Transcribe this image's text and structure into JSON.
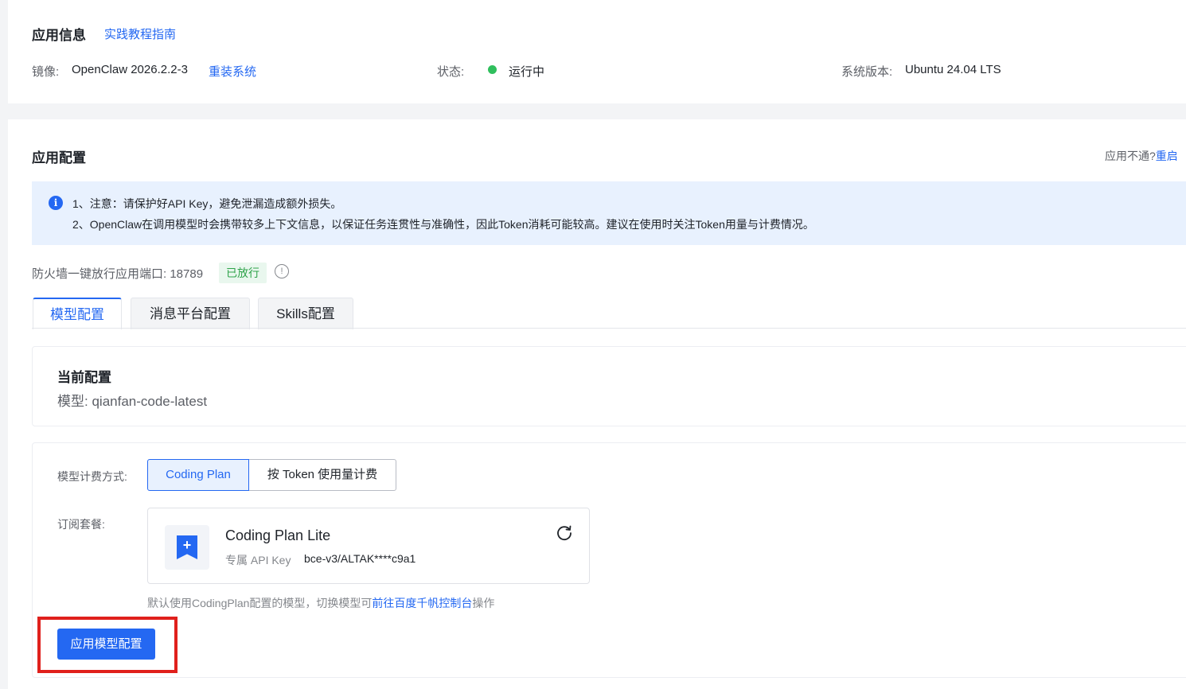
{
  "app_info": {
    "title": "应用信息",
    "tutorial_link": "实践教程指南",
    "image_label": "镜像:",
    "image_value": "OpenClaw 2026.2.2-3",
    "reinstall_link": "重装系统",
    "status_label": "状态:",
    "status_value": "运行中",
    "status_color": "#30bf5d",
    "os_label": "系统版本:",
    "os_value": "Ubuntu 24.04 LTS"
  },
  "app_config": {
    "title": "应用配置",
    "help_text": "应用不通?",
    "help_link": "重启",
    "notice": {
      "icon": "info-icon",
      "line1": "1、注意：请保护好API Key，避免泄漏造成额外损失。",
      "line2": "2、OpenClaw在调用模型时会携带较多上下文信息，以保证任务连贯性与准确性，因此Token消耗可能较高。建议在使用时关注Token用量与计费情况。"
    },
    "firewall_label": "防火墙一键放行应用端口:",
    "firewall_port": "18789",
    "firewall_status": "已放行",
    "tabs": [
      "模型配置",
      "消息平台配置",
      "Skills配置"
    ],
    "active_tab": 0,
    "current": {
      "title": "当前配置",
      "model_label": "模型:",
      "model_value": "qianfan-code-latest"
    },
    "billing": {
      "label": "模型计费方式:",
      "options": [
        "Coding Plan",
        "按 Token 使用量计费"
      ],
      "selected": 0
    },
    "subscription": {
      "label": "订阅套餐:",
      "plan_name": "Coding Plan Lite",
      "api_key_label": "专属 API Key",
      "api_key_value": "bce-v3/ALTAK****c9a1",
      "icon": "bookmark-plus-icon",
      "refresh_icon": "refresh-icon"
    },
    "hint_prefix": "默认使用CodingPlan配置的模型，切换模型可",
    "hint_link": "前往百度千帆控制台",
    "hint_suffix": "操作",
    "apply_button": "应用模型配置",
    "accent_color": "#2468f2",
    "highlight_color": "#e0201c"
  }
}
